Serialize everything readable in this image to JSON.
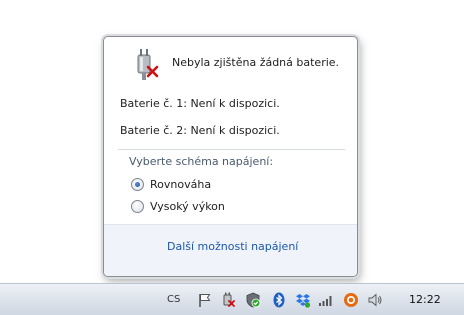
{
  "flyout": {
    "status_title": "Nebyla zjištěna žádná baterie.",
    "battery1": "Baterie č. 1: Není k dispozici.",
    "battery2": "Baterie č. 2: Není k dispozici.",
    "plans_heading": "Vyberte schéma napájení:",
    "plans": [
      {
        "label": "Rovnováha",
        "selected": true
      },
      {
        "label": "Vysoký výkon",
        "selected": false
      }
    ],
    "more_options_link": "Další možnosti napájení"
  },
  "taskbar": {
    "language": "CS",
    "clock": "12:22",
    "tray_icons": [
      "flag-icon",
      "power-icon",
      "security-shield-icon",
      "bluetooth-icon",
      "dropbox-icon",
      "network-signal-icon",
      "browser-icon",
      "volume-icon"
    ]
  },
  "colors": {
    "link": "#1a57a8",
    "footer_bg": "#f0f4fa",
    "taskbar_bg": "#dde3ec"
  }
}
